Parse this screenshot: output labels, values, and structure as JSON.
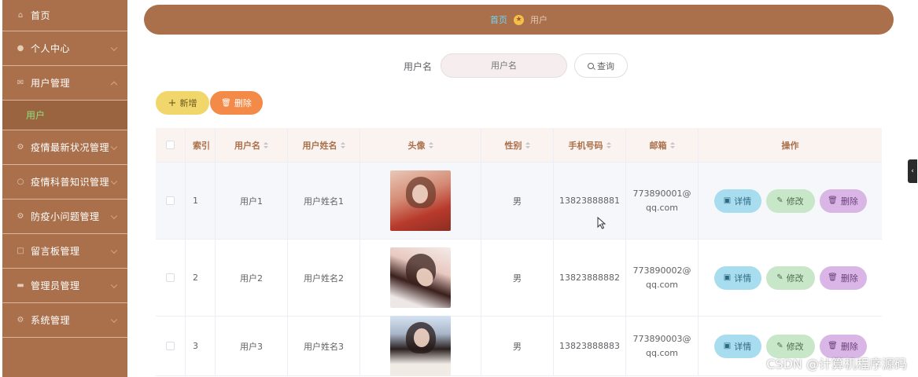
{
  "sidebar": {
    "items": [
      {
        "label": "首页",
        "icon": "home-icon",
        "expanded": false,
        "has_chevron": false
      },
      {
        "label": "个人中心",
        "icon": "user-icon",
        "expanded": false,
        "has_chevron": true
      },
      {
        "label": "用户管理",
        "icon": "mail-icon",
        "expanded": true,
        "has_chevron": true,
        "children": [
          {
            "label": "用户",
            "active": true
          }
        ]
      },
      {
        "label": "疫情最新状况管理",
        "icon": "settings-icon",
        "expanded": false,
        "has_chevron": true
      },
      {
        "label": "疫情科普知识管理",
        "icon": "circle-icon",
        "expanded": false,
        "has_chevron": true
      },
      {
        "label": "防疫小问题管理",
        "icon": "settings-icon",
        "expanded": false,
        "has_chevron": true
      },
      {
        "label": "留言板管理",
        "icon": "message-icon",
        "expanded": false,
        "has_chevron": true
      },
      {
        "label": "管理员管理",
        "icon": "admin-icon",
        "expanded": false,
        "has_chevron": true
      },
      {
        "label": "系统管理",
        "icon": "settings-icon",
        "expanded": false,
        "has_chevron": true
      }
    ]
  },
  "breadcrumb": {
    "home": "首页",
    "current": "用户"
  },
  "search": {
    "label": "用户名",
    "placeholder": "用户名",
    "button": "查询"
  },
  "actions": {
    "add": "新增",
    "delete": "删除"
  },
  "table": {
    "headers": {
      "index": "索引",
      "username": "用户名",
      "realname": "用户姓名",
      "avatar": "头像",
      "gender": "性别",
      "phone": "手机号码",
      "email": "邮箱",
      "ops": "操作"
    },
    "rows": [
      {
        "index": "1",
        "username": "用户1",
        "realname": "用户姓名1",
        "gender": "男",
        "phone": "13823888881",
        "email": "773890001@qq.com"
      },
      {
        "index": "2",
        "username": "用户2",
        "realname": "用户姓名2",
        "gender": "男",
        "phone": "13823888882",
        "email": "773890002@qq.com"
      },
      {
        "index": "3",
        "username": "用户3",
        "realname": "用户姓名3",
        "gender": "男",
        "phone": "13823888883",
        "email": "773890003@qq.com"
      }
    ],
    "row_ops": {
      "detail": "详情",
      "edit": "修改",
      "delete": "删除"
    }
  },
  "watermark": "CSDN @计算机程序源码",
  "colors": {
    "sidebar_bg": "#a9704b",
    "active_sub": "#8ee07a",
    "add_button": "#f0d66b",
    "delete_button": "#f48a48",
    "detail_button": "#a8dcef",
    "edit_button": "#c8e6c8",
    "row_delete_button": "#d9b6e6"
  }
}
